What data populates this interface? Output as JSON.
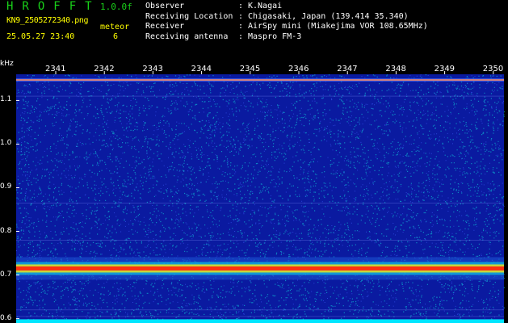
{
  "header": {
    "app_title": "HROFFT",
    "version": "1.0.0f",
    "filename": "KN9_2505272340.png",
    "datetime": "25.05.27 23:40",
    "meteor_label": "meteor",
    "meteor_count": "6"
  },
  "info": [
    {
      "key": "Observer",
      "value": "K.Nagai"
    },
    {
      "key": "Receiving Location",
      "value": "Chigasaki, Japan (139.414 35.340)"
    },
    {
      "key": "Receiver",
      "value": "AirSpy mini (Miakejima VOR 108.65MHz)"
    },
    {
      "key": "Receiving antenna",
      "value": "Maspro FM-3"
    }
  ],
  "chart_data": {
    "type": "heatmap",
    "ylabel": "kHz",
    "x_ticks": [
      "2341",
      "2342",
      "2343",
      "2344",
      "2345",
      "2346",
      "2347",
      "2348",
      "2349",
      "2350"
    ],
    "y_ticks": [
      "1.1",
      "1.0",
      "0.9",
      "0.8",
      "0.7",
      "0.6"
    ],
    "ylim": [
      0.59,
      1.16
    ],
    "bands": [
      {
        "freq_khz": 1.147,
        "strength": "medium",
        "color": "#d08080"
      },
      {
        "freq_khz": 0.715,
        "strength": "strong",
        "color": "#ff3010"
      },
      {
        "freq_khz": 0.58,
        "strength": "saturated",
        "color": "#00e5ff"
      }
    ],
    "background_color": "#0a1aa0",
    "noise_color": "#10e0e0"
  }
}
